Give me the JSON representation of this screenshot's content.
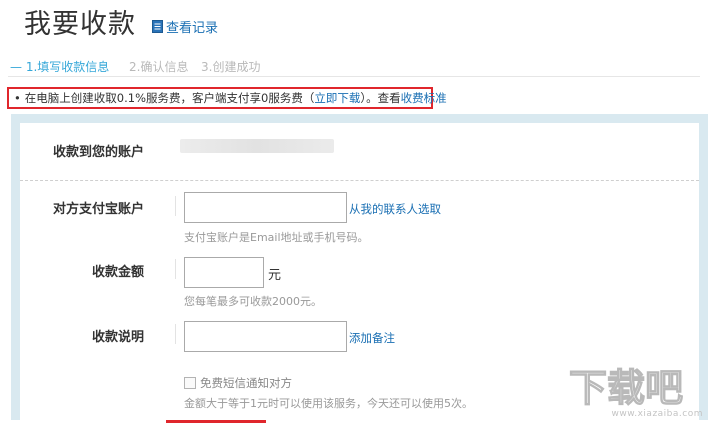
{
  "page": {
    "title": "我要收款",
    "history_link": "查看记录"
  },
  "steps": [
    {
      "label": "1.填写收款信息",
      "state": "active"
    },
    {
      "label": "2.确认信息",
      "state": "pending"
    },
    {
      "label": "3.创建成功",
      "state": "pending"
    }
  ],
  "notice": {
    "bullet": "•",
    "text_before": "在电脑上创建收取0.1%服务费，客户端支付享0服务费（",
    "download_link": "立即下载",
    "text_middle": "）。查看",
    "fee_link": "收费标准"
  },
  "form": {
    "receive_account": {
      "label": "收款到您的账户"
    },
    "payer_account": {
      "label": "对方支付宝账户",
      "value": "",
      "contacts_link": "从我的联系人选取",
      "hint": "支付宝账户是Email地址或手机号码。"
    },
    "amount": {
      "label": "收款金额",
      "value": "",
      "unit": "元",
      "hint": "您每笔最多可收款2000元。"
    },
    "description": {
      "label": "收款说明",
      "value": "",
      "add_note_link": "添加备注"
    },
    "sms": {
      "checked": false,
      "label": "免费短信通知对方",
      "hint": "金额大于等于1元时可以使用该服务，今天还可以使用5次。"
    }
  },
  "watermark": {
    "logo_text": "下载吧",
    "url_text": "www.xiazaiba.com"
  },
  "colors": {
    "accent_blue": "#1a6fb3",
    "active_step": "#35a7d8",
    "notice_border": "#e0262c",
    "panel_border": "#d9e9f0"
  }
}
